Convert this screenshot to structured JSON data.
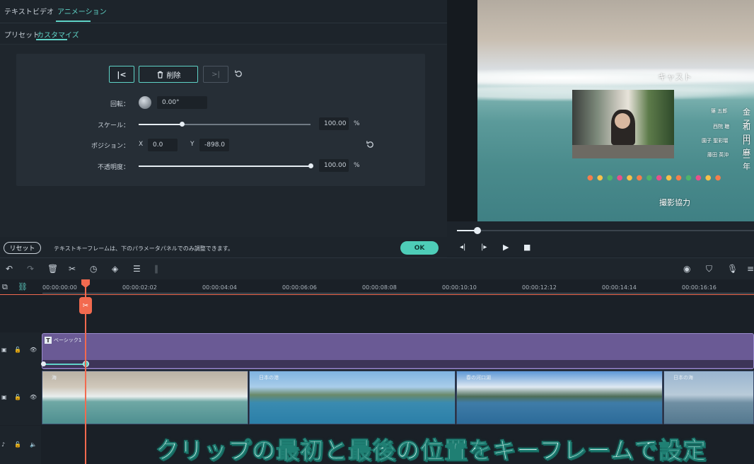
{
  "tabs": [
    "テキスト",
    "ビデオ",
    "アニメーション"
  ],
  "sub_tabs": [
    "プリセット",
    "カスタマイズ"
  ],
  "keyframe": {
    "delete_label": "削除"
  },
  "params": {
    "rotation_label": "回転：",
    "rotation_value": "0.00°",
    "scale_label": "スケール：",
    "scale_value": "100.00",
    "scale_unit": "%",
    "scale_fraction": 0.25,
    "position_label": "ポジション：",
    "x_label": "X",
    "x_value": "0.0",
    "y_label": "Y",
    "y_value": "-898.0",
    "opacity_label": "不透明度：",
    "opacity_value": "100.00",
    "opacity_unit": "%",
    "opacity_fraction": 1.0
  },
  "footer": {
    "reset_label": "リセット",
    "hint": "テキストキーフレームは、下のパラメータパネルでのみ調整できます。",
    "ok_label": "OK"
  },
  "preview": {
    "heading": "キャスト",
    "names": [
      {
        "role": "西院 聴",
        "name": "和田"
      },
      {
        "role": "園子 聖彩瑠",
        "name": "円麻"
      },
      {
        "role": "藤田 英沖",
        "name": "三年"
      }
    ],
    "top_name": "金子",
    "top_role": "篠 五郎",
    "footer_text": "撮影協力",
    "progress_fraction": 0.07
  },
  "timeline": {
    "ticks": [
      "00:00:00:00",
      "00:00:02:02",
      "00:00:04:04",
      "00:00:06:06",
      "00:00:08:08",
      "00:00:10:10",
      "00:00:12:12",
      "00:00:14:14",
      "00:00:16:16"
    ],
    "title_clip": "ベーシック1",
    "video_clips": [
      "海",
      "日本の港",
      "春の河口湖",
      "日本の海"
    ]
  },
  "caption": "クリップの最初と最後の位置をキーフレームで設定",
  "colors": {
    "accent": "#5fd3c7",
    "playhead": "#f26a4f",
    "title_clip": "#6a5a95"
  }
}
